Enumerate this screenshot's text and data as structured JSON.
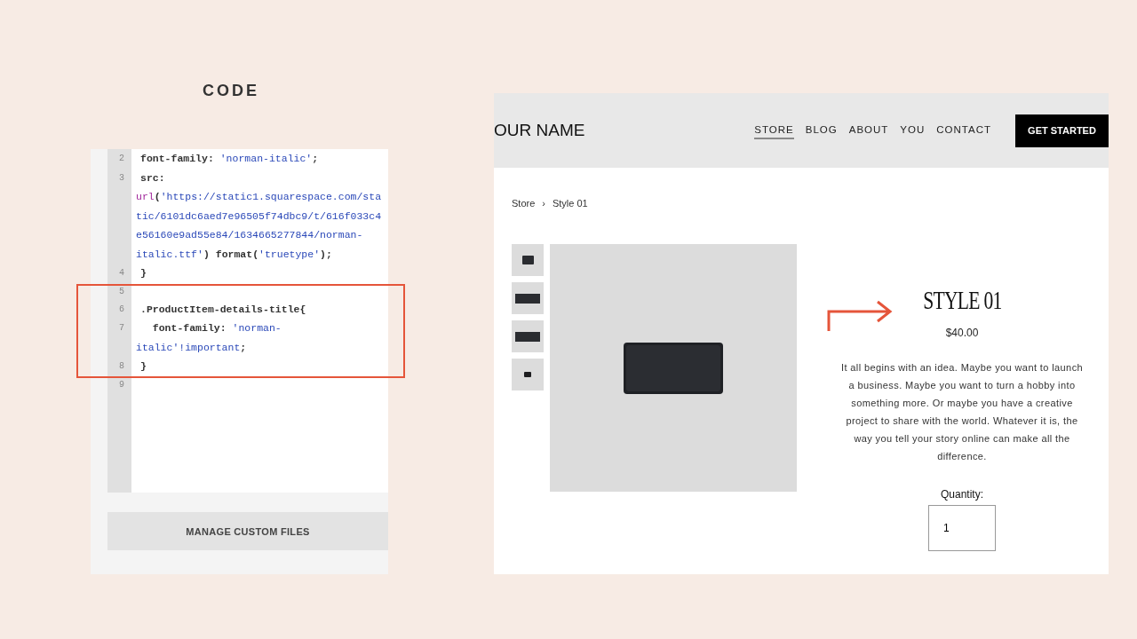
{
  "heading": "CODE",
  "editor": {
    "lines": [
      {
        "number": "2",
        "tokens": [
          {
            "kind": "plain",
            "text": "font-family: "
          },
          {
            "kind": "string",
            "text": "'norman-italic'"
          },
          {
            "kind": "plain",
            "text": ";"
          }
        ]
      },
      {
        "number": "3",
        "tokens": [
          {
            "kind": "plain",
            "text": "src:"
          }
        ]
      },
      {
        "tokens": [
          {
            "kind": "func",
            "text": "url"
          },
          {
            "kind": "plain",
            "text": "("
          },
          {
            "kind": "string",
            "text": "'https://static1.squarespace.com/sta"
          }
        ]
      },
      {
        "tokens": [
          {
            "kind": "string",
            "text": "tic/6101dc6aed7e96505f74dbc9/t/616f033c4"
          }
        ]
      },
      {
        "tokens": [
          {
            "kind": "string",
            "text": "e56160e9ad55e84/1634665277844/norman-"
          }
        ]
      },
      {
        "tokens": [
          {
            "kind": "string",
            "text": "italic.ttf'"
          },
          {
            "kind": "plain",
            "text": ") format("
          },
          {
            "kind": "string",
            "text": "'truetype'"
          },
          {
            "kind": "plain",
            "text": ");"
          }
        ]
      },
      {
        "number": "4",
        "tokens": [
          {
            "kind": "plain",
            "text": "}"
          }
        ]
      },
      {
        "number": "5"
      },
      {
        "number": "6",
        "tokens": [
          {
            "kind": "plain",
            "text": ".ProductItem-details-title{"
          }
        ]
      },
      {
        "number": "7",
        "tokens": [
          {
            "kind": "plain",
            "text": "  font-family: "
          },
          {
            "kind": "string",
            "text": "'norman-"
          }
        ]
      },
      {
        "tokens": [
          {
            "kind": "string",
            "text": "italic'"
          },
          {
            "kind": "keyword",
            "text": "!important"
          },
          {
            "kind": "plain",
            "text": ";"
          }
        ]
      },
      {
        "number": "8",
        "tokens": [
          {
            "kind": "plain",
            "text": "}"
          }
        ]
      },
      {
        "number": "9"
      }
    ],
    "button": "MANAGE CUSTOM FILES"
  },
  "site": {
    "logo": "OUR NAME",
    "nav": [
      {
        "label": "STORE",
        "selected": true
      },
      {
        "label": "BLOG",
        "selected": false
      },
      {
        "label": "ABOUT",
        "selected": false
      },
      {
        "label": "YOU",
        "selected": false
      },
      {
        "label": "CONTACT",
        "selected": false
      }
    ],
    "cta": "GET STARTED",
    "breadcrumb": {
      "items": [
        "Store",
        "Style 01"
      ],
      "separator": "›"
    },
    "product": {
      "title": "STYLE 01",
      "price": "$40.00",
      "description": "It all begins with an idea. Maybe you want to launch a business. Maybe you want to turn a hobby into something more. Or maybe you have a creative project to share with the world. Whatever it is, the way you tell your story online can make all the difference.",
      "quantity_label": "Quantity:",
      "quantity": "1"
    }
  }
}
